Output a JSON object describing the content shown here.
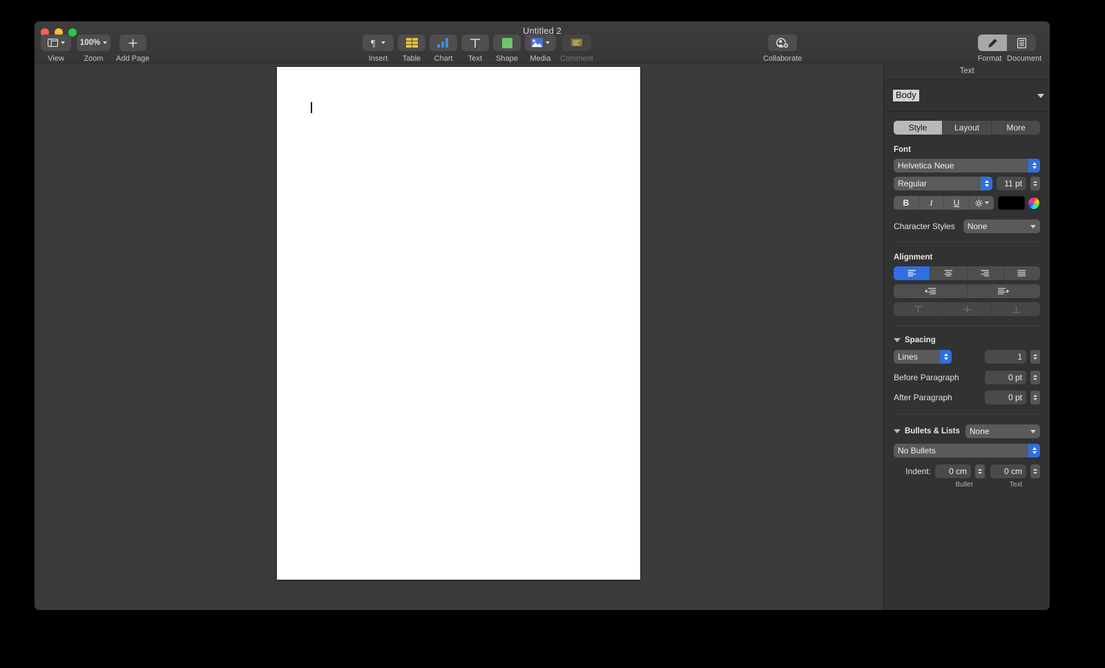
{
  "window": {
    "title": "Untitled 2",
    "traffic_lights": [
      "close-button",
      "minimize-button",
      "zoom-button"
    ]
  },
  "toolbar": {
    "left": [
      {
        "name": "view",
        "label": "View",
        "icon": "sidebar-icon",
        "has_chevron": true
      },
      {
        "name": "zoom",
        "label": "Zoom",
        "value": "100%",
        "has_chevron": true
      },
      {
        "name": "add-page",
        "label": "Add Page",
        "icon": "plus-icon",
        "has_chevron": false
      }
    ],
    "center": [
      {
        "name": "insert",
        "label": "Insert",
        "icon": "pilcrow-icon",
        "has_chevron": true,
        "disabled": false
      },
      {
        "name": "table",
        "label": "Table",
        "icon": "table-icon",
        "has_chevron": false,
        "disabled": false
      },
      {
        "name": "chart",
        "label": "Chart",
        "icon": "chart-icon",
        "has_chevron": false,
        "disabled": false
      },
      {
        "name": "text",
        "label": "Text",
        "icon": "text-t-icon",
        "has_chevron": false,
        "disabled": false
      },
      {
        "name": "shape",
        "label": "Shape",
        "icon": "shape-icon",
        "has_chevron": false,
        "disabled": false
      },
      {
        "name": "media",
        "label": "Media",
        "icon": "media-icon",
        "has_chevron": true,
        "disabled": false
      },
      {
        "name": "comment",
        "label": "Comment",
        "icon": "comment-icon",
        "has_chevron": false,
        "disabled": true
      }
    ],
    "collaborate": {
      "label": "Collaborate",
      "icon": "collaborate-icon"
    },
    "inspector_toggle": {
      "format": {
        "label": "Format",
        "icon": "brush-icon",
        "active": true
      },
      "document": {
        "label": "Document",
        "icon": "document-icon",
        "active": false
      }
    }
  },
  "inspector": {
    "header": "Text",
    "paragraph_style": "Body",
    "tabs": [
      {
        "label": "Style",
        "active": true
      },
      {
        "label": "Layout",
        "active": false
      },
      {
        "label": "More",
        "active": false
      }
    ],
    "font": {
      "section_title": "Font",
      "family": "Helvetica Neue",
      "weight": "Regular",
      "size": "11 pt",
      "bold_label": "B",
      "italic_label": "I",
      "underline_label": "U",
      "options_icon": "gear-icon",
      "color_swatch": "#000000",
      "color_wheel": "color-wheel-icon"
    },
    "character_styles": {
      "label": "Character Styles",
      "value": "None"
    },
    "alignment": {
      "section_title": "Alignment",
      "horizontal": [
        {
          "name": "align-left",
          "active": true
        },
        {
          "name": "align-center",
          "active": false
        },
        {
          "name": "align-right",
          "active": false
        },
        {
          "name": "align-justify",
          "active": false
        }
      ],
      "indent": [
        {
          "name": "decrease-indent",
          "active": false
        },
        {
          "name": "increase-indent",
          "active": false
        }
      ],
      "vertical": [
        {
          "name": "align-top",
          "active": false,
          "disabled": true
        },
        {
          "name": "align-middle",
          "active": false,
          "disabled": true
        },
        {
          "name": "align-bottom",
          "active": false,
          "disabled": true
        }
      ]
    },
    "spacing": {
      "section_title": "Spacing",
      "mode": "Lines",
      "value": "1",
      "before_paragraph_label": "Before Paragraph",
      "before_paragraph_value": "0 pt",
      "after_paragraph_label": "After Paragraph",
      "after_paragraph_value": "0 pt"
    },
    "bullets": {
      "section_title": "Bullets & Lists",
      "list_style": "None",
      "bullet_type": "No Bullets",
      "indent_label": "Indent:",
      "bullet_indent": "0 cm",
      "text_indent": "0 cm",
      "bullet_caption": "Bullet",
      "text_caption": "Text"
    }
  },
  "document": {
    "caret_visible": true
  },
  "colors": {
    "accent_blue": "#2f6fe0",
    "window_bg": "#3a3a3a",
    "inspector_bg": "#323232",
    "page_bg": "#ffffff",
    "traffic_red": "#ff5f57",
    "traffic_yellow": "#febc2e",
    "traffic_green": "#28c840"
  }
}
